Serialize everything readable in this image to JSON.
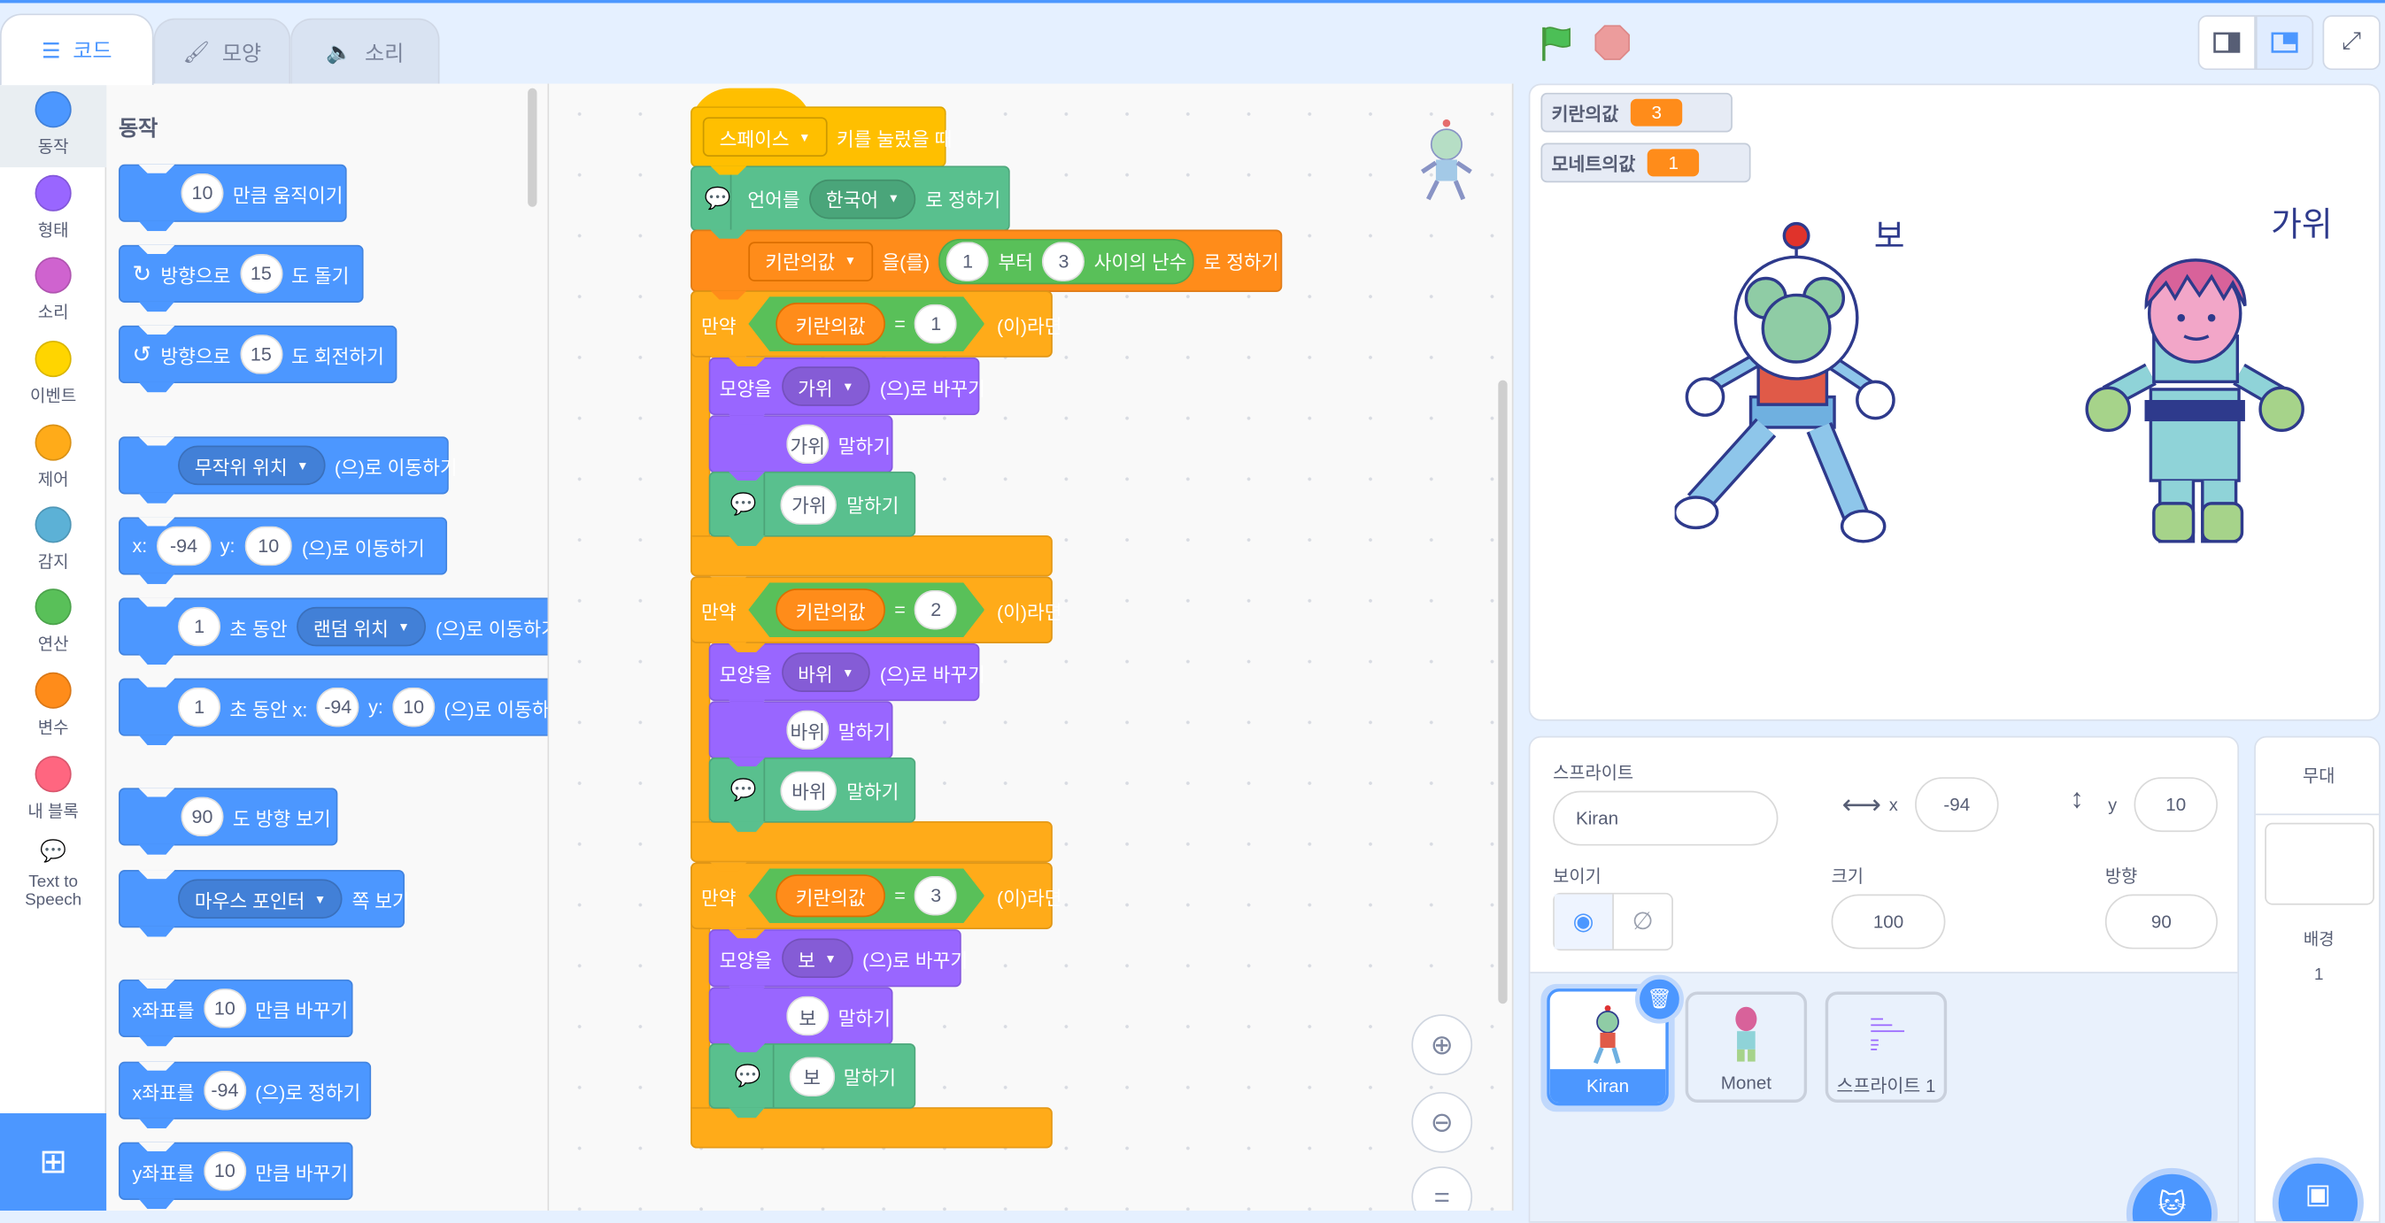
{
  "tabs": [
    {
      "label": "코드",
      "icon": "code-icon",
      "active": true
    },
    {
      "label": "모양",
      "icon": "brush-icon"
    },
    {
      "label": "소리",
      "icon": "speaker-icon"
    }
  ],
  "categories": [
    {
      "label": "동작",
      "color": "#4c97ff"
    },
    {
      "label": "형태",
      "color": "#9966ff"
    },
    {
      "label": "소리",
      "color": "#cf63cf"
    },
    {
      "label": "이벤트",
      "color": "#ffd500"
    },
    {
      "label": "제어",
      "color": "#ffab19"
    },
    {
      "label": "감지",
      "color": "#5cb1d6"
    },
    {
      "label": "연산",
      "color": "#59c059"
    },
    {
      "label": "변수",
      "color": "#ff8c1a"
    },
    {
      "label": "내 블록",
      "color": "#ff6680"
    },
    {
      "label": "Text to Speech",
      "color": "#0fbd8c",
      "icon": "text-to-speech-icon"
    }
  ],
  "palette": {
    "title": "동작",
    "blocks": [
      [
        {
          "i": "10"
        },
        {
          "t": "만큼 움직이기"
        }
      ],
      [
        {
          "icon": "↻",
          "name": "rotate-right-icon"
        },
        {
          "t": "방향으로"
        },
        {
          "i": "15"
        },
        {
          "t": "도 돌기"
        }
      ],
      [
        {
          "icon": "↺",
          "name": "rotate-left-icon"
        },
        {
          "t": "방향으로"
        },
        {
          "i": "15"
        },
        {
          "t": "도 회전하기"
        }
      ],
      [
        {
          "d": "무작위 위치"
        },
        {
          "t": "(으)로 이동하기"
        }
      ],
      [
        {
          "t": "x:"
        },
        {
          "i": "-94"
        },
        {
          "t": "y:"
        },
        {
          "i": "10"
        },
        {
          "t": "(으)로 이동하기"
        }
      ],
      [
        {
          "i": "1"
        },
        {
          "t": "초 동안"
        },
        {
          "d": "랜덤 위치"
        },
        {
          "t": "(으)로 이동하기"
        }
      ],
      [
        {
          "i": "1"
        },
        {
          "t": "초 동안 x:"
        },
        {
          "i": "-94"
        },
        {
          "t": "y:"
        },
        {
          "i": "10"
        },
        {
          "t": "(으)로 이동하기"
        }
      ],
      [
        {
          "i": "90"
        },
        {
          "t": "도 방향 보기"
        }
      ],
      [
        {
          "d": "마우스 포인터"
        },
        {
          "t": "쪽 보기"
        }
      ],
      [
        {
          "t": "x좌표를"
        },
        {
          "i": "10"
        },
        {
          "t": "만큼 바꾸기"
        }
      ],
      [
        {
          "t": "x좌표를"
        },
        {
          "i": "-94"
        },
        {
          "t": "(으)로 정하기"
        }
      ],
      [
        {
          "t": "y좌표를"
        },
        {
          "i": "10"
        },
        {
          "t": "만큼 바꾸기"
        }
      ]
    ]
  },
  "script": {
    "hat": [
      {
        "dsq": "스페이스"
      },
      {
        "t": "키를 눌렀을 때"
      }
    ],
    "set_language": [
      {
        "tts": 1
      },
      {
        "t": "언어를"
      },
      {
        "d": "한국어"
      },
      {
        "t": "로 정하기"
      }
    ],
    "set_var": [
      {
        "dsq": "키란의값"
      },
      {
        "t": "을(를)"
      },
      {
        "rand": [
          "1",
          "부터",
          "3",
          "사이의 난수"
        ]
      },
      {
        "t": "로 정하기"
      }
    ],
    "ifs": [
      {
        "if_label": "만약",
        "var": "키란의값",
        "eq": "=",
        "value": "1",
        "then": "(이)라면",
        "costume_pre": "모양을",
        "costume": "가위",
        "costume_post": "(으)로 바꾸기",
        "say": "가위",
        "say_label": "말하기",
        "speak": "가위",
        "speak_label": "말하기"
      },
      {
        "if_label": "만약",
        "var": "키란의값",
        "eq": "=",
        "value": "2",
        "then": "(이)라면",
        "costume_pre": "모양을",
        "costume": "바위",
        "costume_post": "(으)로 바꾸기",
        "say": "바위",
        "say_label": "말하기",
        "speak": "바위",
        "speak_label": "말하기"
      },
      {
        "if_label": "만약",
        "var": "키란의값",
        "eq": "=",
        "value": "3",
        "then": "(이)라면",
        "costume_pre": "모양을",
        "costume": "보",
        "costume_post": "(으)로 바꾸기",
        "say": "보",
        "say_label": "말하기",
        "speak": "보",
        "speak_label": "말하기"
      }
    ]
  },
  "stage": {
    "monitors": [
      {
        "label": "키란의값",
        "value": "3"
      },
      {
        "label": "모네트의값",
        "value": "1"
      }
    ],
    "kiran_text": "보",
    "monet_text": "가위"
  },
  "sprite_info": {
    "title": "스프라이트",
    "name": "Kiran",
    "x_label": "x",
    "x": "-94",
    "y_label": "y",
    "y": "10",
    "show_label": "보이기",
    "size_label": "크기",
    "size": "100",
    "direction_label": "방향",
    "direction": "90"
  },
  "sprites": [
    {
      "name": "Kiran",
      "selected": true
    },
    {
      "name": "Monet"
    },
    {
      "name": "스프라이트 1"
    }
  ],
  "stage_panel": {
    "title": "무대",
    "backdrop_label": "배경",
    "backdrop_count": "1"
  },
  "colors": {
    "motion": "#4c97ff",
    "looks": "#9966ff",
    "control": "#ffab19",
    "events": "#ffbf00",
    "variables": "#ff8c1a",
    "operators": "#59c059",
    "tts": "#59c08e"
  }
}
